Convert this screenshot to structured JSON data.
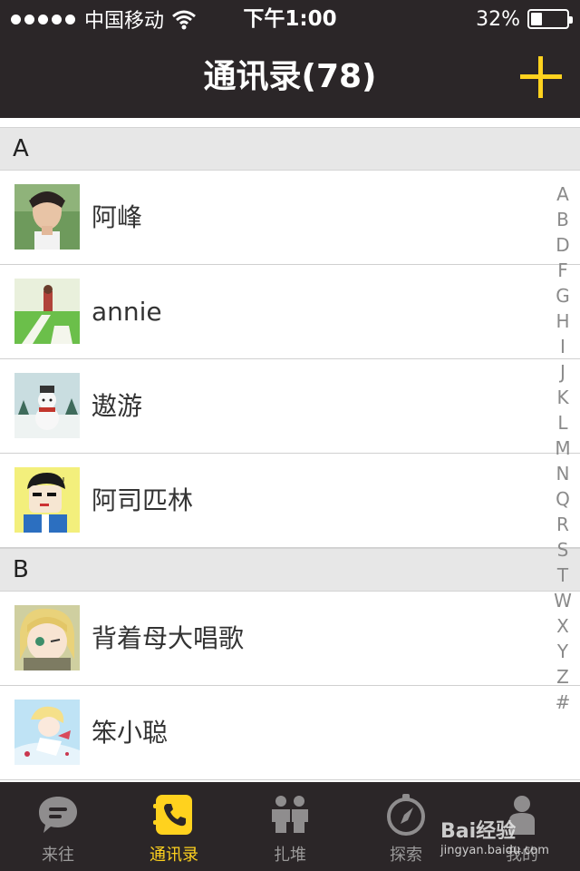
{
  "status_bar": {
    "carrier": "中国移动",
    "time": "下午1:00",
    "battery": "32%"
  },
  "header": {
    "title": "通讯录(78)"
  },
  "sections": [
    {
      "letter": "A",
      "contacts": [
        {
          "name": "阿峰",
          "avatar": "man-portrait"
        },
        {
          "name": "annie",
          "avatar": "girl-on-field"
        },
        {
          "name": "遨游",
          "avatar": "snowman"
        },
        {
          "name": "阿司匹林",
          "avatar": "cartoon-man"
        }
      ]
    },
    {
      "letter": "B",
      "contacts": [
        {
          "name": "背着母大唱歌",
          "avatar": "anime-girl"
        },
        {
          "name": "笨小聪",
          "avatar": "anime-boy"
        }
      ]
    }
  ],
  "index_letters": [
    "A",
    "B",
    "D",
    "F",
    "G",
    "H",
    "I",
    "J",
    "K",
    "L",
    "M",
    "N",
    "Q",
    "R",
    "S",
    "T",
    "W",
    "X",
    "Y",
    "Z",
    "#"
  ],
  "tabs": [
    {
      "label": "来往",
      "icon": "chat-bubble-icon",
      "active": false
    },
    {
      "label": "通讯录",
      "icon": "phone-book-icon",
      "active": true
    },
    {
      "label": "扎堆",
      "icon": "people-group-icon",
      "active": false
    },
    {
      "label": "探索",
      "icon": "compass-icon",
      "active": false
    },
    {
      "label": "我的",
      "icon": "person-icon",
      "active": false
    }
  ],
  "watermark": {
    "text": "Bai经验",
    "url": "jingyan.baidu.com"
  },
  "colors": {
    "bar_background": "#2b2628",
    "accent": "#ffd21e",
    "section_background": "#e7e7e7"
  }
}
